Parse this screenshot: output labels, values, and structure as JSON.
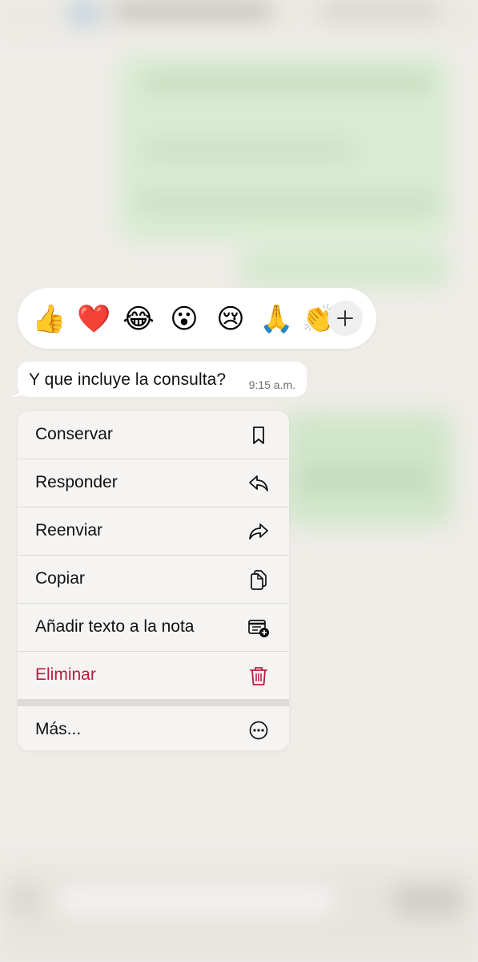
{
  "reactions": {
    "emojis": [
      {
        "name": "thumbs-up",
        "glyph": "👍"
      },
      {
        "name": "red-heart",
        "glyph": "❤️"
      },
      {
        "name": "tears-of-joy",
        "glyph": "😂"
      },
      {
        "name": "surprised-face",
        "glyph": "😮"
      },
      {
        "name": "crying-face",
        "glyph": "😢"
      },
      {
        "name": "folded-hands",
        "glyph": "🙏"
      },
      {
        "name": "clapping-hands",
        "glyph": "👏"
      }
    ],
    "more_icon": "plus-icon"
  },
  "message": {
    "text": "Y que incluye la consulta?",
    "time": "9:15 a.m."
  },
  "menu": {
    "items": [
      {
        "label": "Conservar",
        "icon": "bookmark-icon"
      },
      {
        "label": "Responder",
        "icon": "reply-icon"
      },
      {
        "label": "Reenviar",
        "icon": "forward-icon"
      },
      {
        "label": "Copiar",
        "icon": "copy-icon"
      },
      {
        "label": "Añadir texto a la nota",
        "icon": "add-to-note-icon"
      },
      {
        "label": "Eliminar",
        "icon": "trash-icon",
        "danger": true
      }
    ],
    "more": {
      "label": "Más...",
      "icon": "more-icon"
    }
  },
  "colors": {
    "danger": "#b81c40",
    "menu_background": "#f5f4f3",
    "chat_background": "#efece8",
    "bubble": "#ffffff"
  }
}
